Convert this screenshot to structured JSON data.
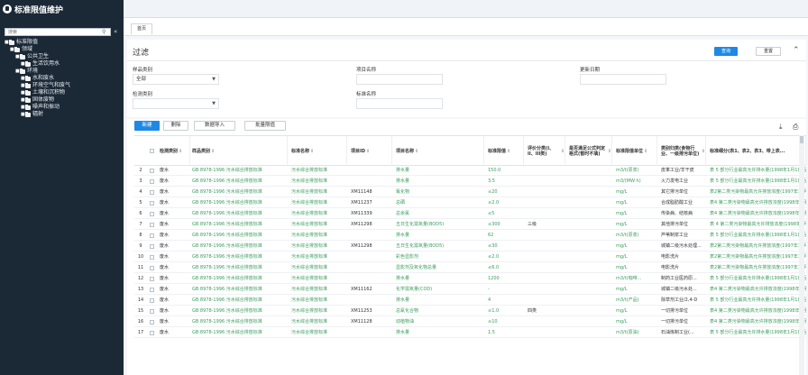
{
  "app": {
    "title": "标准限值维护"
  },
  "sidebar": {
    "search_placeholder": "搜索",
    "tree": [
      {
        "label": "标准限值",
        "level": 0
      },
      {
        "label": "领域",
        "level": 1
      },
      {
        "label": "公共卫生",
        "level": 2
      },
      {
        "label": "生活饮用水",
        "level": 3
      },
      {
        "label": "环境",
        "level": 2
      },
      {
        "label": "水和废水",
        "level": 3
      },
      {
        "label": "环境空气和废气",
        "level": 3
      },
      {
        "label": "土壤和沉积物",
        "level": 3
      },
      {
        "label": "固体废物",
        "level": 3
      },
      {
        "label": "噪声和振动",
        "level": 3
      },
      {
        "label": "辐射",
        "level": 3
      }
    ]
  },
  "tabs": {
    "home": "首页"
  },
  "filter": {
    "title": "过滤",
    "query_label": "查询",
    "reset_label": "重置",
    "sample_type_label": "样品类别",
    "sample_type_value": "全部",
    "item_name_label": "项目名称",
    "update_date_label": "更新日期",
    "test_type_label": "检测类别",
    "standard_name_label": "标准名称"
  },
  "toolbar": {
    "add": "新建",
    "delete": "删除",
    "import": "数据导入",
    "batch": "批量限值"
  },
  "table": {
    "headers": [
      "检测类别",
      "样品类别",
      "标准名称",
      "项目ID",
      "项目名称",
      "标准限值",
      "评价分类(I、II、III类)",
      "是否满足公式判定格式(暂时不填)",
      "标准限值单位",
      "类别归类(食物行业、一级排污单位)",
      "标准细分(表1、表2、表3、带上表..."
    ],
    "header_marks": [
      "⇕",
      "⇕",
      "⇕",
      "⇕",
      "⇕",
      "⇕",
      "⇕",
      "⇕",
      "⇕",
      "⇕",
      ""
    ],
    "rows": [
      {
        "num": "2",
        "type": "废水",
        "std": "GB 8978-1996 污水综合排放标准",
        "name": "污水综合排放标准",
        "id": "",
        "item": "排水量",
        "limit": "150.0",
        "grade": "",
        "fmt": "",
        "unit": "m3/t(原浆)",
        "cat": "皮革工业/羊干皮",
        "sub": "表 5 部分行业最高允许排水量(1998年1月1日后建设的单位)"
      },
      {
        "num": "3",
        "type": "废水",
        "std": "GB 8978-1996 污水综合排放标准",
        "name": "污水综合排放标准",
        "id": "",
        "item": "排水量",
        "limit": "3.5",
        "grade": "",
        "fmt": "",
        "unit": "m3/(MW·h)",
        "cat": "火力发电工业",
        "sub": "表 5 部分行业最高允许排水量(1998年1月1日后建设的单位)"
      },
      {
        "num": "4",
        "type": "废水",
        "std": "GB 8978-1996 污水综合排放标准",
        "name": "污水综合排放标准",
        "id": "XM11148",
        "item": "氟化物",
        "limit": "≤20",
        "grade": "",
        "fmt": "",
        "unit": "mg/L",
        "cat": "其它排污单位",
        "sub": "表2第二类污染物最高允许排放浓度(1997年12月31日之前建设的单位)"
      },
      {
        "num": "5",
        "type": "废水",
        "std": "GB 8978-1996 污水综合排放标准",
        "name": "污水综合排放标准",
        "id": "XM11237",
        "item": "总硒",
        "limit": "≤2.0",
        "grade": "",
        "fmt": "",
        "unit": "mg/L",
        "cat": "合成脂肪酸工业",
        "sub": "表4 第二类污染物最高允许排放浓度(1998年1月1日后建设的单位)"
      },
      {
        "num": "6",
        "type": "废水",
        "std": "GB 8978-1996 污水综合排放标准",
        "name": "污水综合排放标准",
        "id": "XM11339",
        "item": "总余氯",
        "limit": "≤5",
        "grade": "",
        "fmt": "",
        "unit": "mg/L",
        "cat": "传染病、结核病",
        "sub": "表4 第二类污染物最高允许排放浓度(1998年1月1日后建设的单位)"
      },
      {
        "num": "7",
        "type": "废水",
        "std": "GB 8978-1996 污水综合排放标准",
        "name": "污水综合排放标准",
        "id": "XM11298",
        "item": "五日生化需氧量(BOD5)",
        "limit": "≤300",
        "grade": "三级",
        "fmt": "",
        "unit": "mg/L",
        "cat": "其他排污单位",
        "sub": "表 4 第二类污染物最高允许排放浓度(1998年1月1日后建设的单位)"
      },
      {
        "num": "8",
        "type": "废水",
        "std": "GB 8978-1996 污水综合排放标准",
        "name": "污水综合排放标准",
        "id": "",
        "item": "排水量",
        "limit": "62",
        "grade": "",
        "fmt": "",
        "unit": "m3/t(原浆)",
        "cat": "芦苇制浆工业",
        "sub": "表 5 部分行业最高允许排水量(1998年1月1日后建设的单位)"
      },
      {
        "num": "9",
        "type": "废水",
        "std": "GB 8978-1996 污水综合排放标准",
        "name": "污水综合排放标准",
        "id": "XM11298",
        "item": "五日生化需氧量(BOD5)",
        "limit": "≤30",
        "grade": "",
        "fmt": "",
        "unit": "mg/L",
        "cat": "城镇二级污水处理...",
        "sub": "表2第二类污染物最高允许排放浓度(1997年12月31日之前建设的单位)"
      },
      {
        "num": "10",
        "type": "废水",
        "std": "GB 8978-1996 污水综合排放标准",
        "name": "污水综合排放标准",
        "id": "",
        "item": "彩色显影剂",
        "limit": "≤2.0",
        "grade": "",
        "fmt": "",
        "unit": "mg/L",
        "cat": "电影洗片",
        "sub": "表2第二类污染物最高允许排放浓度(1997年12月31日之前建设的单位)"
      },
      {
        "num": "11",
        "type": "废水",
        "std": "GB 8978-1996 污水综合排放标准",
        "name": "污水综合排放标准",
        "id": "",
        "item": "显影剂及氧化物总量",
        "limit": "≤6.0",
        "grade": "",
        "fmt": "",
        "unit": "mg/L",
        "cat": "电影洗片",
        "sub": "表2第二类污染物最高允许排放浓度(1997年12月31日之前建设的单位)"
      },
      {
        "num": "12",
        "type": "废水",
        "std": "GB 8978-1996 污水综合排放标准",
        "name": "污水综合排放标准",
        "id": "",
        "item": "排水量",
        "limit": "1200",
        "grade": "",
        "fmt": "",
        "unit": "m3/t(咖啡...",
        "cat": "制药工业医药原...",
        "sub": "表 5 部分行业最高允许排水量(1998年1月1日后建设的单位)"
      },
      {
        "num": "13",
        "type": "废水",
        "std": "GB 8978-1996 污水综合排放标准",
        "name": "污水综合排放标准",
        "id": "XM11162",
        "item": "化学需氧量(COD)",
        "limit": "-",
        "grade": "",
        "fmt": "",
        "unit": "mg/L",
        "cat": "城镇二级污水处...",
        "sub": "表4 第二类污染物最高允许排放浓度(1998年1月1日后建设的单位)"
      },
      {
        "num": "14",
        "type": "废水",
        "std": "GB 8978-1996 污水综合排放标准",
        "name": "污水综合排放标准",
        "id": "",
        "item": "排水量",
        "limit": "4",
        "grade": "",
        "fmt": "",
        "unit": "m3/t(产品)",
        "cat": "除草剂工业/2,4-D",
        "sub": "表 5 部分行业最高允许排水量(1998年1月1日后建设的单位)"
      },
      {
        "num": "15",
        "type": "废水",
        "std": "GB 8978-1996 污水综合排放标准",
        "name": "污水综合排放标准",
        "id": "XM11253",
        "item": "总氰化合物",
        "limit": "≤1.0",
        "grade": "四类",
        "fmt": "",
        "unit": "mg/L",
        "cat": "一切排污单位",
        "sub": "表4 第二类污染物最高允许排放浓度(1998年1月1日后建设的单位)"
      },
      {
        "num": "16",
        "type": "废水",
        "std": "GB 8978-1996 污水综合排放标准",
        "name": "污水综合排放标准",
        "id": "XM11128",
        "item": "动植物油",
        "limit": "≤10",
        "grade": "",
        "fmt": "",
        "unit": "mg/L",
        "cat": "一切排污单位",
        "sub": "表4 第二类污染物最高允许排放浓度(1998年1月1日后建设的单位)"
      },
      {
        "num": "17",
        "type": "废水",
        "std": "GB 8978-1996 污水综合排放标准",
        "name": "污水综合排放标准",
        "id": "",
        "item": "排水量",
        "limit": "1.5",
        "grade": "",
        "fmt": "",
        "unit": "m3/t(原油)",
        "cat": "石油炼制工业(...",
        "sub": "表 5 部分行业最高允许排水量(1998年1月1日后建设的单位)"
      }
    ]
  },
  "colors": {
    "sidebar_bg": "#1b2836",
    "primary": "#1e88e5",
    "link": "#3a9d5d"
  },
  "icons": {
    "logo": "gear-logo-icon",
    "search": "search-icon",
    "collapse": "double-chevron-left-icon",
    "fold": "chevron-up-icon",
    "download": "download-icon",
    "print": "print-icon"
  }
}
